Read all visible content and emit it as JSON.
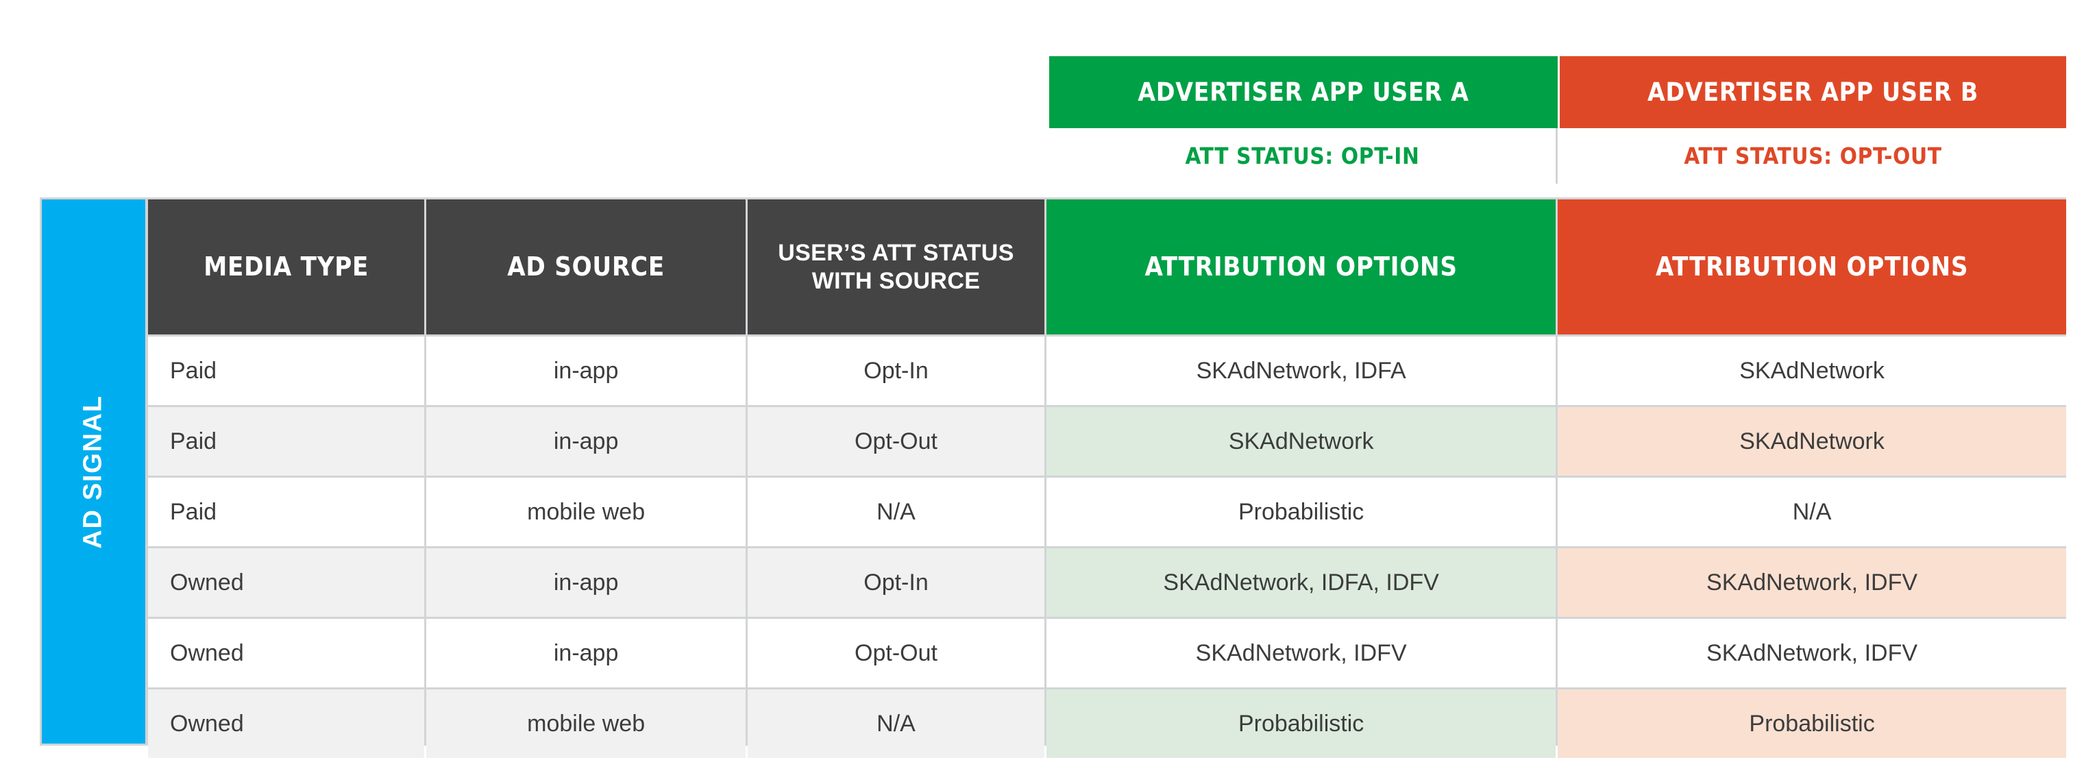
{
  "banners": {
    "user_a": {
      "title": "ADVERTISER APP USER A",
      "att_status": "ATT STATUS: OPT-IN",
      "color": "#00a046"
    },
    "user_b": {
      "title": "ADVERTISER APP USER B",
      "att_status": "ATT STATUS: OPT-OUT",
      "color": "#df4827"
    }
  },
  "side_label": {
    "text": "AD SIGNAL",
    "color": "#00aeef"
  },
  "table": {
    "headers": {
      "media_type": "MEDIA TYPE",
      "ad_source": "AD SOURCE",
      "user_att_status": "USER’S ATT STATUS WITH SOURCE",
      "attribution_a": "ATTRIBUTION OPTIONS",
      "attribution_b": "ATTRIBUTION OPTIONS"
    },
    "rows": [
      {
        "media_type": "Paid",
        "ad_source": "in-app",
        "user_att_status": "Opt-In",
        "attribution_a": "SKAdNetwork, IDFA",
        "attribution_b": "SKAdNetwork"
      },
      {
        "media_type": "Paid",
        "ad_source": "in-app",
        "user_att_status": "Opt-Out",
        "attribution_a": "SKAdNetwork",
        "attribution_b": "SKAdNetwork"
      },
      {
        "media_type": "Paid",
        "ad_source": "mobile web",
        "user_att_status": "N/A",
        "attribution_a": "Probabilistic",
        "attribution_b": "N/A"
      },
      {
        "media_type": "Owned",
        "ad_source": "in-app",
        "user_att_status": "Opt-In",
        "attribution_a": "SKAdNetwork, IDFA, IDFV",
        "attribution_b": "SKAdNetwork, IDFV"
      },
      {
        "media_type": "Owned",
        "ad_source": "in-app",
        "user_att_status": "Opt-Out",
        "attribution_a": "SKAdNetwork, IDFV",
        "attribution_b": "SKAdNetwork, IDFV"
      },
      {
        "media_type": "Owned",
        "ad_source": "mobile web",
        "user_att_status": "N/A",
        "attribution_a": "Probabilistic",
        "attribution_b": "Probabilistic"
      }
    ]
  },
  "colors": {
    "green": "#00a046",
    "orange": "#df4827",
    "blue": "#00aeef",
    "header_dark": "#444444",
    "grid_line": "#d2d4d6",
    "row_alt": "#f1f1f1",
    "tint_green": "#dcebdd",
    "tint_orange": "#fae0d1"
  }
}
